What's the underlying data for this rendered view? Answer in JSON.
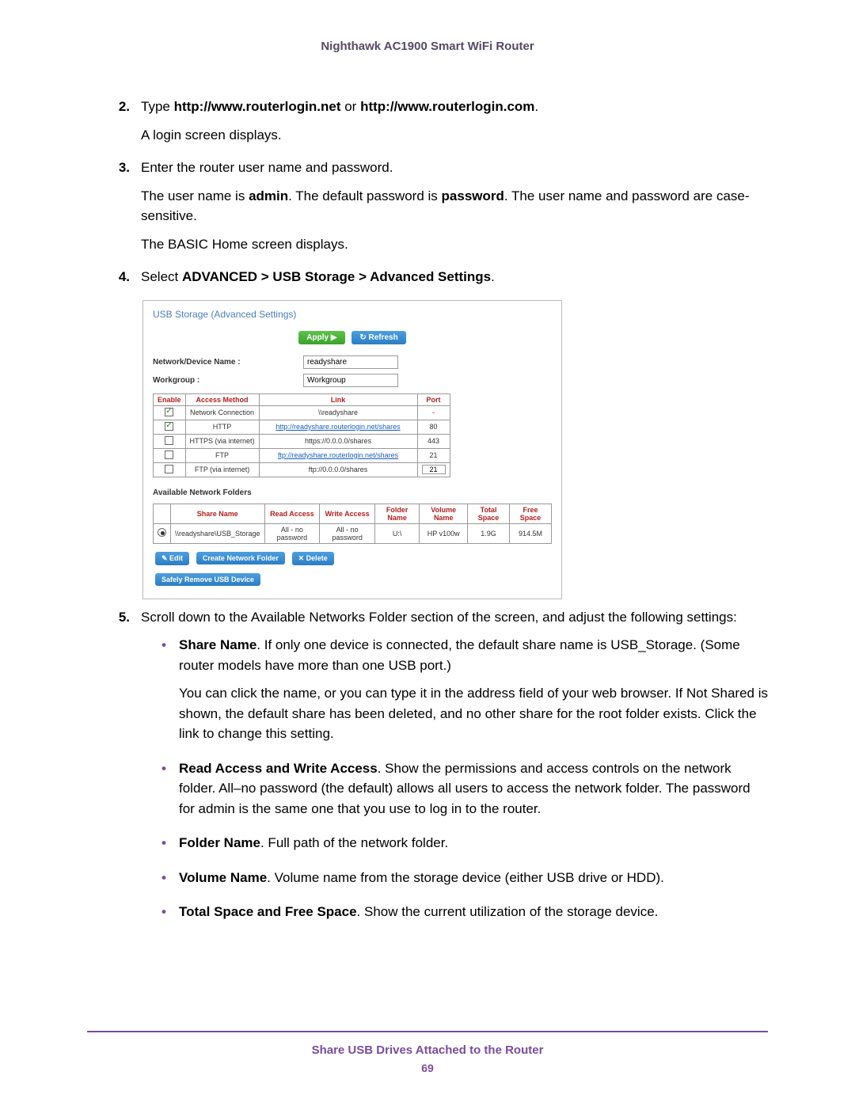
{
  "header": {
    "title": "Nighthawk AC1900 Smart WiFi Router"
  },
  "steps": {
    "s2": {
      "num": "2.",
      "line1_pre": "Type ",
      "line1_b1": "http://www.routerlogin.net",
      "line1_mid": " or ",
      "line1_b2": "http://www.routerlogin.com",
      "line1_post": ".",
      "line2": "A login screen displays."
    },
    "s3": {
      "num": "3.",
      "line1": "Enter the router user name and password.",
      "line2_pre": "The user name is ",
      "line2_b1": "admin",
      "line2_mid": ". The default password is ",
      "line2_b2": "password",
      "line2_post": ". The user name and password are case-sensitive.",
      "line3": "The BASIC Home screen displays."
    },
    "s4": {
      "num": "4.",
      "line1_pre": "Select ",
      "line1_b": "ADVANCED > USB Storage > Advanced Settings",
      "line1_post": "."
    },
    "s5": {
      "num": "5.",
      "line1": "Scroll down to the Available Networks Folder section of the screen, and adjust the following settings:"
    }
  },
  "ui": {
    "title": "USB Storage (Advanced Settings)",
    "apply": "Apply ▶",
    "refresh": "↻ Refresh",
    "device_name_label": "Network/Device Name :",
    "device_name_value": "readyshare",
    "workgroup_label": "Workgroup :",
    "workgroup_value": "Workgroup",
    "cols": {
      "enable": "Enable",
      "access": "Access Method",
      "link": "Link",
      "port": "Port"
    },
    "rows": [
      {
        "checked": true,
        "access": "Network Connection",
        "link_text": "\\\\readyshare",
        "link_is_link": false,
        "port": "-",
        "port_input": false
      },
      {
        "checked": true,
        "access": "HTTP",
        "link_text": "http://readyshare.routerlogin.net/shares",
        "link_is_link": true,
        "port": "80",
        "port_input": false
      },
      {
        "checked": false,
        "access": "HTTPS (via internet)",
        "link_text": "https://0.0.0.0/shares",
        "link_is_link": false,
        "port": "443",
        "port_input": false
      },
      {
        "checked": false,
        "access": "FTP",
        "link_text": "ftp://readyshare.routerlogin.net/shares",
        "link_is_link": true,
        "port": "21",
        "port_input": false
      },
      {
        "checked": false,
        "access": "FTP (via internet)",
        "link_text": "ftp://0.0.0.0/shares",
        "link_is_link": false,
        "port": "21",
        "port_input": true
      }
    ],
    "folders_label": "Available Network Folders",
    "fcols": {
      "share": "Share Name",
      "read": "Read Access",
      "write": "Write Access",
      "folder": "Folder Name",
      "volume": "Volume Name",
      "total": "Total Space",
      "free": "Free Space"
    },
    "frow": {
      "share": "\\\\readyshare\\USB_Storage",
      "read": "All - no password",
      "write": "All - no password",
      "folder": "U:\\",
      "volume": "HP v100w",
      "total": "1.9G",
      "free": "914.5M"
    },
    "edit": "✎ Edit",
    "create": "Create Network Folder",
    "delete": "✕ Delete",
    "remove": "Safely Remove USB Device"
  },
  "bullets": {
    "b1": {
      "label": "Share Name",
      "p1": ". If only one device is connected, the default share name is USB_Storage. (Some router models have more than one USB port.)",
      "p2": "You can click the name, or you can type it in the address field of your web browser. If Not Shared is shown, the default share has been deleted, and no other share for the root folder exists. Click the link to change this setting."
    },
    "b2": {
      "label": "Read Access and Write Access",
      "text": ". Show the permissions and access controls on the network folder. All–no password (the default) allows all users to access the network folder. The password for admin is the same one that you use to log in to the router."
    },
    "b3": {
      "label": "Folder Name",
      "text": ". Full path of the network folder."
    },
    "b4": {
      "label": "Volume Name",
      "text": ". Volume name from the storage device (either USB drive or HDD)."
    },
    "b5": {
      "label": "Total Space and Free Space",
      "text": ". Show the current utilization of the storage device."
    }
  },
  "footer": {
    "title": "Share USB Drives Attached to the Router",
    "page": "69"
  }
}
